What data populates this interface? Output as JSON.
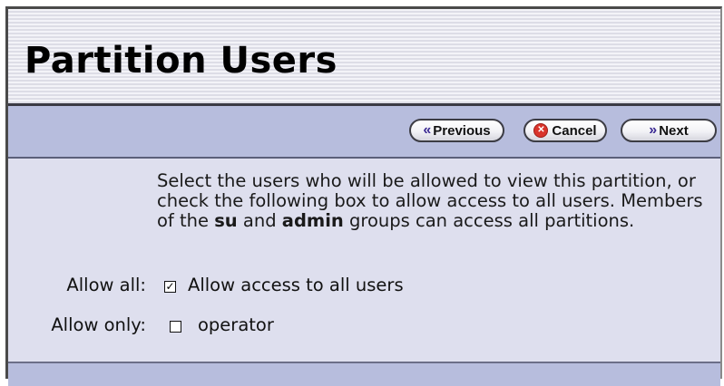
{
  "page": {
    "title": "Partition Users"
  },
  "toolbar": {
    "previous_label": "Previous",
    "cancel_label": "Cancel",
    "next_label": "Next",
    "previous_icon": "«",
    "next_icon": "»",
    "cancel_icon": "⊗"
  },
  "description": {
    "part1": "Select the users who will be allowed to view this partition, or check the following box to allow access to all users. Members of the ",
    "group1": "su",
    "part2": " and ",
    "group2": "admin",
    "part3": " groups can access all partitions."
  },
  "allow_all": {
    "label": "Allow all:",
    "checked_mark": "✓",
    "option_label": "Allow access to all users",
    "checked": true
  },
  "allow_only": {
    "label": "Allow only:",
    "users": [
      {
        "name": "operator",
        "checked": false
      }
    ]
  },
  "colors": {
    "toolbar": "#b7bddd",
    "panel": "#dedfee",
    "cancel_icon": "#d9342b",
    "nav_icon": "#3b2a93"
  }
}
